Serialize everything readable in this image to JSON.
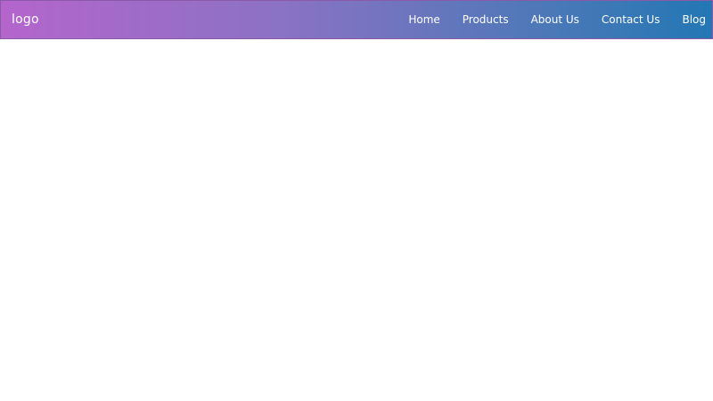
{
  "navbar": {
    "logo": "logo",
    "links": [
      {
        "label": "Home"
      },
      {
        "label": "Products"
      },
      {
        "label": "About Us"
      },
      {
        "label": "Contact Us"
      },
      {
        "label": "Blog"
      }
    ]
  },
  "colors": {
    "gradient_start": "#b465cc",
    "gradient_end": "#2377b4",
    "text": "#ffffff",
    "background": "#ffffff"
  }
}
